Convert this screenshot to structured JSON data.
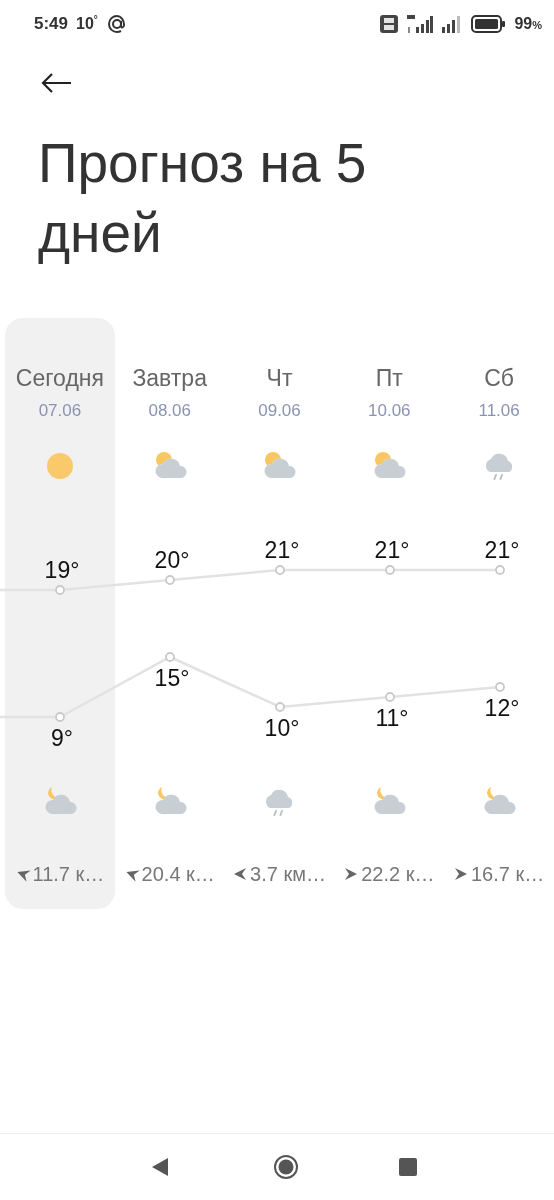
{
  "status_bar": {
    "time": "5:49",
    "temperature": "10$^{°}$",
    "battery": "99",
    "battery_unit": "%"
  },
  "title": "Прогноз на 5 дней",
  "days": [
    {
      "name": "Сегодня",
      "date": "07.06",
      "selected": true,
      "day_icon": {
        "kind": "sun"
      },
      "high": "19°",
      "low": "9°",
      "night_icon": {
        "kind": "moon-cloud"
      },
      "wind_arrow": {
        "kind": "southwest"
      },
      "wind": "11.7 к…"
    },
    {
      "name": "Завтра",
      "date": "08.06",
      "selected": false,
      "day_icon": {
        "kind": "sun-cloud"
      },
      "high": "20°",
      "low": "15°",
      "night_icon": {
        "kind": "moon-cloud"
      },
      "wind_arrow": {
        "kind": "southwest"
      },
      "wind": "20.4 к…"
    },
    {
      "name": "Чт",
      "date": "09.06",
      "selected": false,
      "day_icon": {
        "kind": "sun-cloud"
      },
      "high": "21°",
      "low": "10°",
      "night_icon": {
        "kind": "rain"
      },
      "wind_arrow": {
        "kind": "west"
      },
      "wind": "3.7 км…"
    },
    {
      "name": "Пт",
      "date": "10.06",
      "selected": false,
      "day_icon": {
        "kind": "sun-cloud"
      },
      "high": "21°",
      "low": "11°",
      "night_icon": {
        "kind": "moon-cloud"
      },
      "wind_arrow": {
        "kind": "east"
      },
      "wind": "22.2 к…"
    },
    {
      "name": "Сб",
      "date": "11.06",
      "selected": false,
      "day_icon": {
        "kind": "rain"
      },
      "high": "21°",
      "low": "12°",
      "night_icon": {
        "kind": "moon-cloud"
      },
      "wind_arrow": {
        "kind": "east"
      },
      "wind": "16.7 к…"
    }
  ]
}
